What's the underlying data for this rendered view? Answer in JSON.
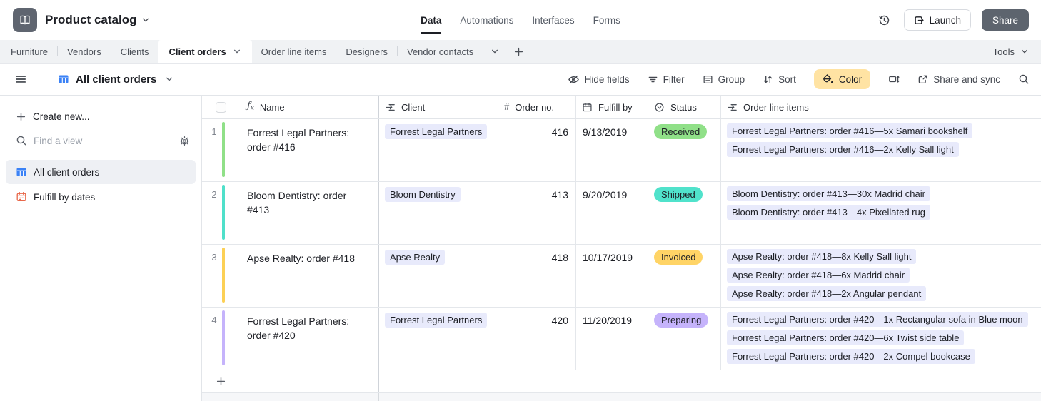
{
  "topbar": {
    "title": "Product catalog",
    "app_icon": "book-icon",
    "nav": [
      {
        "label": "Data",
        "active": true
      },
      {
        "label": "Automations",
        "active": false
      },
      {
        "label": "Interfaces",
        "active": false
      },
      {
        "label": "Forms",
        "active": false
      }
    ],
    "history_icon": "history-icon",
    "launch_label": "Launch",
    "share_label": "Share"
  },
  "tabbar": {
    "tabs": [
      {
        "label": "Furniture",
        "active": false
      },
      {
        "label": "Vendors",
        "active": false
      },
      {
        "label": "Clients",
        "active": false
      },
      {
        "label": "Client orders",
        "active": true
      },
      {
        "label": "Order line items",
        "active": false
      },
      {
        "label": "Designers",
        "active": false
      },
      {
        "label": "Vendor contacts",
        "active": false
      }
    ],
    "overflow_icon": "chevron-down-icon",
    "add_icon": "plus-icon",
    "tools_label": "Tools"
  },
  "viewbar": {
    "view_name": "All client orders",
    "view_icon": "grid-view-icon",
    "actions": [
      {
        "name": "hide-fields",
        "icon": "eye-slash",
        "label": "Hide fields"
      },
      {
        "name": "filter",
        "icon": "filter",
        "label": "Filter"
      },
      {
        "name": "group",
        "icon": "group",
        "label": "Group"
      },
      {
        "name": "sort",
        "icon": "sort",
        "label": "Sort"
      },
      {
        "name": "color",
        "icon": "color",
        "label": "Color",
        "highlighted": true
      },
      {
        "name": "row-height",
        "icon": "row-height",
        "label": ""
      },
      {
        "name": "share-and-sync",
        "icon": "share-sync",
        "label": "Share and sync"
      },
      {
        "name": "search",
        "icon": "search",
        "label": ""
      }
    ]
  },
  "sidebar": {
    "create_new_label": "Create new...",
    "find_placeholder": "Find a view",
    "views": [
      {
        "icon": "grid-view",
        "label": "All client orders",
        "selected": true
      },
      {
        "icon": "calendar-view",
        "label": "Fulfill by dates",
        "selected": false
      }
    ]
  },
  "table": {
    "columns": [
      {
        "icon": "formula",
        "label": "Name"
      },
      {
        "icon": "linked-record",
        "label": "Client"
      },
      {
        "icon": "hash",
        "label": "Order no."
      },
      {
        "icon": "calendar",
        "label": "Fulfill by"
      },
      {
        "icon": "single-select",
        "label": "Status"
      },
      {
        "icon": "linked-record",
        "label": "Order line items"
      }
    ],
    "rows": [
      {
        "num": "1",
        "row_color": "#90e088",
        "name": "Forrest Legal Partners: order #416",
        "client": "Forrest Legal Partners",
        "order_no": "416",
        "fulfill_by": "9/13/2019",
        "status": {
          "label": "Received",
          "color": "#90e088"
        },
        "line_items": [
          "Forrest Legal Partners: order #416—5x Samari bookshelf",
          "Forrest Legal Partners: order #416—2x Kelly Sall light"
        ]
      },
      {
        "num": "2",
        "row_color": "#4fe0ca",
        "name": "Bloom Dentistry: order #413",
        "client": "Bloom Dentistry",
        "order_no": "413",
        "fulfill_by": "9/20/2019",
        "status": {
          "label": "Shipped",
          "color": "#50e2cb"
        },
        "line_items": [
          "Bloom Dentistry: order #413—30x Madrid chair",
          "Bloom Dentistry: order #413—4x Pixellated rug"
        ]
      },
      {
        "num": "3",
        "row_color": "#fcd055",
        "name": "Apse Realty: order #418",
        "client": "Apse Realty",
        "order_no": "418",
        "fulfill_by": "10/17/2019",
        "status": {
          "label": "Invoiced",
          "color": "#ffd466"
        },
        "line_items": [
          "Apse Realty: order #418—8x Kelly Sall light",
          "Apse Realty: order #418—6x Madrid chair",
          "Apse Realty: order #418—2x Angular pendant"
        ]
      },
      {
        "num": "4",
        "row_color": "#c5b3fb",
        "name": "Forrest Legal Partners: order #420",
        "client": "Forrest Legal Partners",
        "order_no": "420",
        "fulfill_by": "11/20/2019",
        "status": {
          "label": "Preparing",
          "color": "#c5b3fb"
        },
        "line_items": [
          "Forrest Legal Partners: order #420—1x Rectangular sofa in Blue moon",
          "Forrest Legal Partners: order #420—6x Twist side table",
          "Forrest Legal Partners: order #420—2x Compel bookcase"
        ]
      }
    ]
  },
  "colors": {
    "chip_bg": "#e8eafb",
    "color_button_bg": "#ffe3a3",
    "accent_blue": "#3b82f6",
    "calendar_orange": "#e8684a",
    "share_button_bg": "#5d646e"
  }
}
